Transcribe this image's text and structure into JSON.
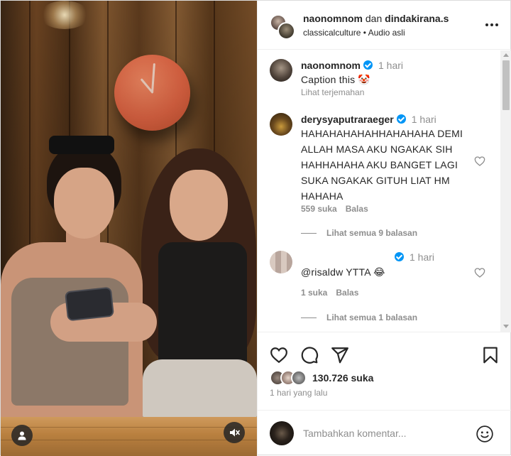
{
  "media": {
    "icons": {
      "account": "user-icon",
      "audio": "speaker-muted-icon"
    }
  },
  "header": {
    "author": "naonomnom",
    "joiner": "dan",
    "collaborator": "dindakirana.s",
    "collection": "classicalculture",
    "separator": "•",
    "audio": "Audio asli",
    "more_icon": "more-horizontal-icon"
  },
  "caption": {
    "username": "naonomnom",
    "verified": true,
    "time": "1 hari",
    "text": "Caption this 🤡",
    "translate": "Lihat terjemahan"
  },
  "comments": [
    {
      "username": "derysyaputraraeger",
      "verified": true,
      "time": "1 hari",
      "text": "HAHAHAHAHAHHAHAHAHA DEMI ALLAH MASA AKU NGAKAK SIH HAHHAHAHA AKU BANGET LAGI SUKA NGAKAK GITUH LIAT HM HAHAHA",
      "likes": "559 suka",
      "reply": "Balas",
      "view_replies": "Lihat semua 9 balasan"
    },
    {
      "username": "",
      "verified": true,
      "time": "1 hari",
      "text": "@risaldw YTTA 😂",
      "likes": "1 suka",
      "reply": "Balas",
      "view_replies": "Lihat semua 1 balasan"
    }
  ],
  "actions": {
    "likes": "130.726 suka",
    "posted": "1 hari yang lalu",
    "icons": [
      "heart-icon",
      "comment-icon",
      "share-icon",
      "bookmark-icon"
    ]
  },
  "add_comment": {
    "placeholder": "Tambahkan komentar...",
    "emoji_icon": "emoji-icon"
  },
  "colors": {
    "verified": "#0095f6",
    "secondary_text": "#8e8e8e",
    "primary_text": "#262626",
    "clock": "#e36644"
  }
}
